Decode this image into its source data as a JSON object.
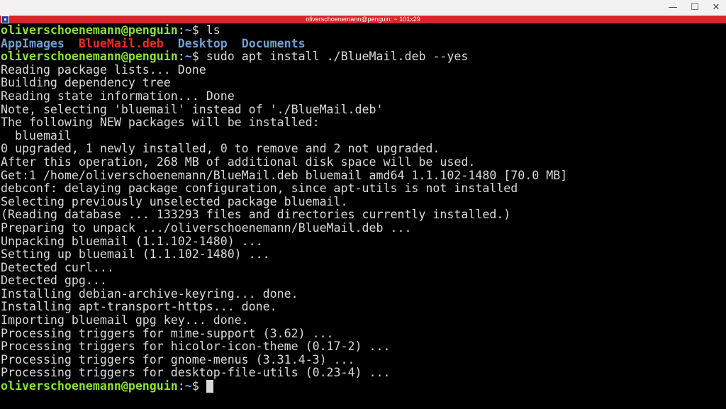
{
  "window": {
    "title": "oliverschoenemann@penguin: ~ 101x29",
    "controls": {
      "minimize": "—",
      "maximize": "☐",
      "close": "✕"
    }
  },
  "terminal": {
    "prompt": {
      "user": "oliverschoenemann@penguin",
      "sep": ":",
      "path": "~",
      "symbol": "$ "
    },
    "cmd_ls": "ls",
    "ls_items": [
      "AppImages",
      "BlueMail.deb",
      "Desktop",
      "Documents"
    ],
    "cmd_install": "sudo apt install ./BlueMail.deb --yes",
    "output": [
      "Reading package lists... Done",
      "Building dependency tree",
      "Reading state information... Done",
      "Note, selecting 'bluemail' instead of './BlueMail.deb'",
      "The following NEW packages will be installed:",
      "  bluemail",
      "0 upgraded, 1 newly installed, 0 to remove and 2 not upgraded.",
      "After this operation, 268 MB of additional disk space will be used.",
      "Get:1 /home/oliverschoenemann/BlueMail.deb bluemail amd64 1.1.102-1480 [70.0 MB]",
      "debconf: delaying package configuration, since apt-utils is not installed",
      "Selecting previously unselected package bluemail.",
      "(Reading database ... 133293 files and directories currently installed.)",
      "Preparing to unpack .../oliverschoenemann/BlueMail.deb ...",
      "Unpacking bluemail (1.1.102-1480) ...",
      "Setting up bluemail (1.1.102-1480) ...",
      "Detected curl...",
      "Detected gpg...",
      "Installing debian-archive-keyring... done.",
      "Installing apt-transport-https... done.",
      "Importing bluemail gpg key... done.",
      "Processing triggers for mime-support (3.62) ...",
      "Processing triggers for hicolor-icon-theme (0.17-2) ...",
      "Processing triggers for gnome-menus (3.31.4-3) ...",
      "Processing triggers for desktop-file-utils (0.23-4) ..."
    ]
  }
}
